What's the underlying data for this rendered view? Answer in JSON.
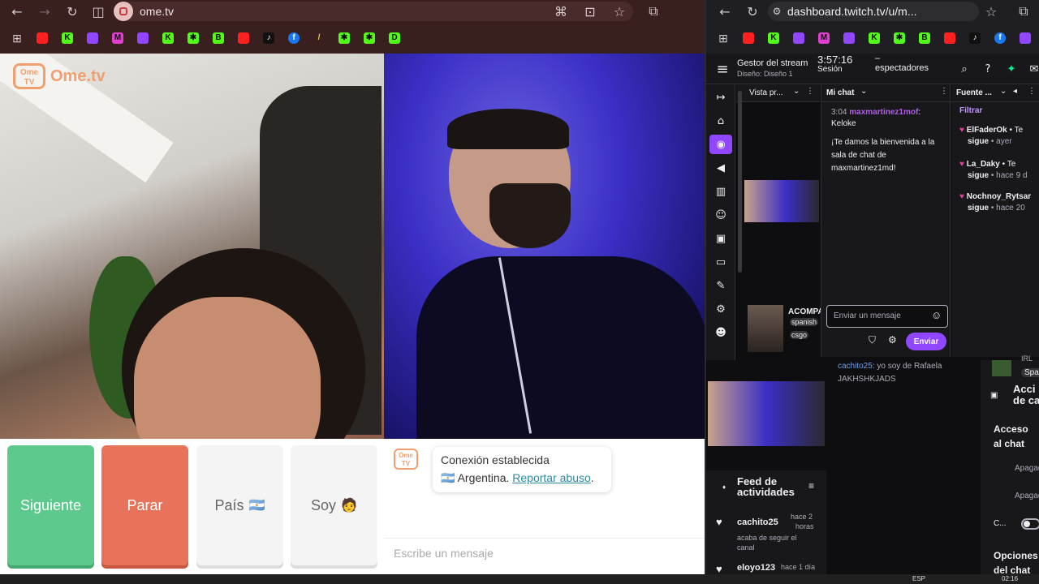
{
  "left_browser": {
    "url": "ome.tv",
    "logo_text": "Ome.tv",
    "logo_badge": "Ome\nTV",
    "buttons": {
      "next": "Siguiente",
      "stop": "Parar",
      "country": "País",
      "country_flag": "🇦🇷",
      "gender": "Soy",
      "gender_emoji": "🧑"
    },
    "chat": {
      "status_title": "Conexión establecida",
      "country_flag": "🇦🇷",
      "country": "Argentina.",
      "report_link": "Reportar abuso",
      "report_period": ".",
      "input_placeholder": "Escribe un mensaje"
    },
    "bookmarks": [
      "youtube",
      "kick",
      "twitch",
      "m",
      "twitch",
      "kick",
      "kick-alt",
      "b",
      "youtube",
      "tiktok",
      "facebook",
      "mic",
      "kick-alt",
      "kick-alt",
      "d"
    ]
  },
  "right_browser": {
    "url": "dashboard.twitch.tv/u/m...",
    "header": {
      "title": "Gestor del stream",
      "subtitle": "Diseño: Diseño 1",
      "session_time": "3:57:16",
      "session_label": "Sesión",
      "viewers_value": "–",
      "viewers_label": "espectadores"
    },
    "preview_panel": {
      "title": "Vista pr...",
      "stream_title": "ACOMPA",
      "tag_1": "spanish",
      "tag_2": "csgo"
    },
    "chat_panel": {
      "title": "Mi chat",
      "message_time": "3:04",
      "message_user": "maxmartinez1mof",
      "message_sep": ":",
      "message_text": "Keloke",
      "welcome_line_1": "¡Te damos la bienvenida a la",
      "welcome_line_2": "sala de chat de",
      "welcome_line_3": "maxmartinez1md!",
      "input_placeholder": "Enviar un mensaje",
      "send_button": "Enviar"
    },
    "events_panel": {
      "title": "Fuente ...",
      "filter": "Filtrar",
      "items": [
        {
          "user": "ElFaderOk",
          "action": "• Te",
          "action2": "sigue",
          "time": "• ayer"
        },
        {
          "user": "La_Daky",
          "action": "• Te",
          "action2": "sigue",
          "time": "• hace 9 d"
        },
        {
          "user": "Nochnoy_Rytsar",
          "action": "",
          "action2": "sigue",
          "time": "• hace 20"
        }
      ]
    },
    "under_chat": {
      "user": "cachito25",
      "text": "yo soy de Rafaela",
      "text2": "JAKHSHKJADS"
    },
    "activity_feed": {
      "title_1": "Feed de",
      "title_2": "actividades",
      "items": [
        {
          "user": "cachito25",
          "time_1": "hace 2",
          "time_2": "horas",
          "detail_1": "acaba de seguir el",
          "detail_2": "canal"
        },
        {
          "user": "eloyo123",
          "time_1": "hace 1 día",
          "time_2": "",
          "detail_1": "",
          "detail_2": ""
        }
      ]
    },
    "right_column": {
      "irl": "IRL",
      "spa": "Spa",
      "acciones_1": "Acci",
      "acciones_2": "de ca",
      "acceso_1": "Acceso",
      "acceso_2": "al chat",
      "apagado_1": "Apagad",
      "apagado_2": "Apagad",
      "c_label": "C...",
      "opciones_1": "Opciones",
      "opciones_2": "del chat"
    }
  },
  "taskbar": {
    "lang": "ESP",
    "time": "02:16"
  },
  "colors": {
    "next_button": "#5ec98c",
    "stop_button": "#e8735b",
    "twitch_purple": "#9147ff",
    "left_chrome": "#3a1f1f",
    "ome_orange": "#f0a070"
  }
}
